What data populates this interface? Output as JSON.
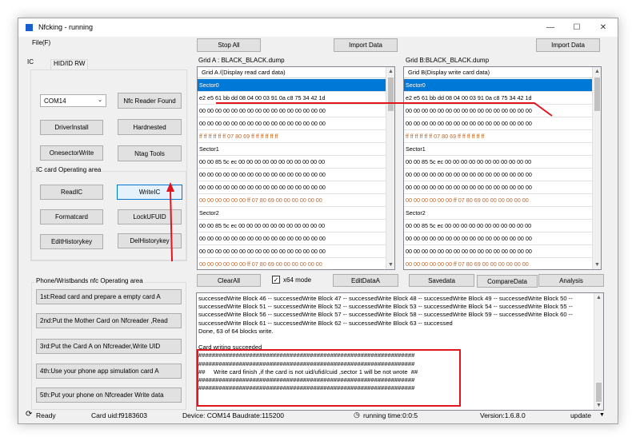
{
  "window": {
    "title": "Nfcking - running",
    "controls": [
      "—",
      "☐",
      "✕"
    ]
  },
  "menu": {
    "file": "File(F)"
  },
  "toolbar": {
    "stop_all": "Stop All",
    "import_data_a": "Import Data",
    "import_data_b": "Import Data"
  },
  "tabs": {
    "ic": "IC",
    "hid": "HID/ID RW"
  },
  "left": {
    "port_select": "COM14",
    "nfc_reader_found": "Nfc Reader Found",
    "driver_install": "DriverInstall",
    "hardnested": "Hardnested",
    "onesector_write": "OnesectorWrite",
    "ntag_tools": "Ntag Tools",
    "ic_area_label": "IC card Operating area",
    "read_ic": "ReadIC",
    "write_ic": "WriteIC",
    "format_card": "Formatcard",
    "lock_ufuid": "LockUFUID",
    "edit_history": "EditHistorykey",
    "del_history": "DelHistorykey",
    "phone_area_label": "Phone/Wristbands nfc Operating area",
    "steps": [
      "1st:Read card and prepare a empty card A",
      "2nd:Put the Mother Card on Nfcreader ,Read",
      "3rd:Put the Card A on Nfcreader,Write UID",
      "4th:Use your phone app simulation card A",
      "5th:Put your phone on Nfcreader Write data"
    ]
  },
  "grid_a": {
    "title": "Grid A : BLACK_BLACK.dump",
    "header": "Grid A /(Display read card data)",
    "rows": [
      {
        "text": "Sector0",
        "style": "sel"
      },
      {
        "text": "e2 e5 61 bb dd 08 04 00 03 91 0a c8 75 34 42 1d",
        "style": ""
      },
      {
        "text": "00 00 00 00 00 00 00 00 00 00 00 00 00 00 00 00",
        "style": ""
      },
      {
        "text": "00 00 00 00 00 00 00 00 00 00 00 00 00 00 00 00",
        "style": ""
      },
      {
        "text": "ff ff ff ff ff ff 07 80 69 ff ff ff ff ff ff",
        "style": "orange"
      },
      {
        "text": "Sector1",
        "style": ""
      },
      {
        "text": "00 00 85 5c ec 00 00 00 00 00 00 00 00 00 00 00",
        "style": ""
      },
      {
        "text": "00 00 00 00 00 00 00 00 00 00 00 00 00 00 00 00",
        "style": ""
      },
      {
        "text": "00 00 00 00 00 00 00 00 00 00 00 00 00 00 00 00",
        "style": ""
      },
      {
        "text": "00 00 00 00 00 00 ff 07 80 69 00 00 00 00 00 00",
        "style": "orange"
      },
      {
        "text": "Sector2",
        "style": ""
      },
      {
        "text": "00 00 85 5c ec 00 00 00 00 00 00 00 00 00 00 00",
        "style": ""
      },
      {
        "text": "00 00 00 00 00 00 00 00 00 00 00 00 00 00 00 00",
        "style": ""
      },
      {
        "text": "00 00 00 00 00 00 00 00 00 00 00 00 00 00 00 00",
        "style": ""
      },
      {
        "text": "00 00 00 00 00 00 ff 07 80 69 00 00 00 00 00 00",
        "style": "orange"
      }
    ]
  },
  "grid_b": {
    "title": "Grid B:BLACK_BLACK.dump",
    "header": "Grid B(Display write card data)",
    "rows": [
      {
        "text": "Sector0",
        "style": "sel"
      },
      {
        "text": "e2 e5 61 bb dd 08 04 00 03 91 0a c8 75 34 42 1d",
        "style": ""
      },
      {
        "text": "00 00 00 00 00 00 00 00 00 00 00 00 00 00 00 00",
        "style": ""
      },
      {
        "text": "00 00 00 00 00 00 00 00 00 00 00 00 00 00 00 00",
        "style": ""
      },
      {
        "text": "ff ff ff ff ff ff 07 80 69 ff ff ff ff ff ff",
        "style": "orange"
      },
      {
        "text": "Sector1",
        "style": ""
      },
      {
        "text": "00 00 85 5c ec 00 00 00 00 00 00 00 00 00 00 00",
        "style": ""
      },
      {
        "text": "00 00 00 00 00 00 00 00 00 00 00 00 00 00 00 00",
        "style": ""
      },
      {
        "text": "00 00 00 00 00 00 00 00 00 00 00 00 00 00 00 00",
        "style": ""
      },
      {
        "text": "00 00 00 00 00 00 ff 07 80 69 00 00 00 00 00 00",
        "style": "orange"
      },
      {
        "text": "Sector2",
        "style": ""
      },
      {
        "text": "00 00 85 5c ec 00 00 00 00 00 00 00 00 00 00 00",
        "style": ""
      },
      {
        "text": "00 00 00 00 00 00 00 00 00 00 00 00 00 00 00 00",
        "style": ""
      },
      {
        "text": "00 00 00 00 00 00 00 00 00 00 00 00 00 00 00 00",
        "style": ""
      },
      {
        "text": "00 00 00 00 00 00 ff 07 80 69 00 00 00 00 00 00",
        "style": "orange"
      }
    ]
  },
  "actions": {
    "clear_all": "ClearAll",
    "x64_mode": "x64 mode",
    "x64_checked": "✓",
    "edit_data_a": "EditDataA",
    "save_data": "Savedata",
    "compare_data": "CompareData",
    "analysis": "Analysis"
  },
  "log": {
    "text": "successedWrite Block 46 -- successedWrite Block 47 -- successedWrite Block 48 -- successedWrite Block 49 -- successedWrite Block 50 -- successedWrite Block 51 -- successedWrite Block 52 -- successedWrite Block 53 -- successedWrite Block 54 -- successedWrite Block 55 -- successedWrite Block 56 -- successedWrite Block 57 -- successedWrite Block 58 -- successedWrite Block 59 -- successedWrite Block 60 -- successedWrite Block 61 -- successedWrite Block 62 -- successedWrite Block 63 -- successed\nDone, 63 of 64 blocks write.\n\nCard writing succeeded\n################################################################\n################################################################\n##     Write card finish ,if the card is not uid/ufid/cuid ,sector 1 will be not wrote  ##\n################################################################\n################################################################"
  },
  "status": {
    "ready": "Ready",
    "card_uid": "Card uid:f9183603",
    "device": "Device: COM14  Baudrate:115200",
    "running_time": "running time:0:0:5",
    "version": "Version:1.6.8.0",
    "update": "update"
  },
  "colors": {
    "accent": "#0078d7",
    "annotation": "#e0151e",
    "orange_row": "#c8641e"
  }
}
